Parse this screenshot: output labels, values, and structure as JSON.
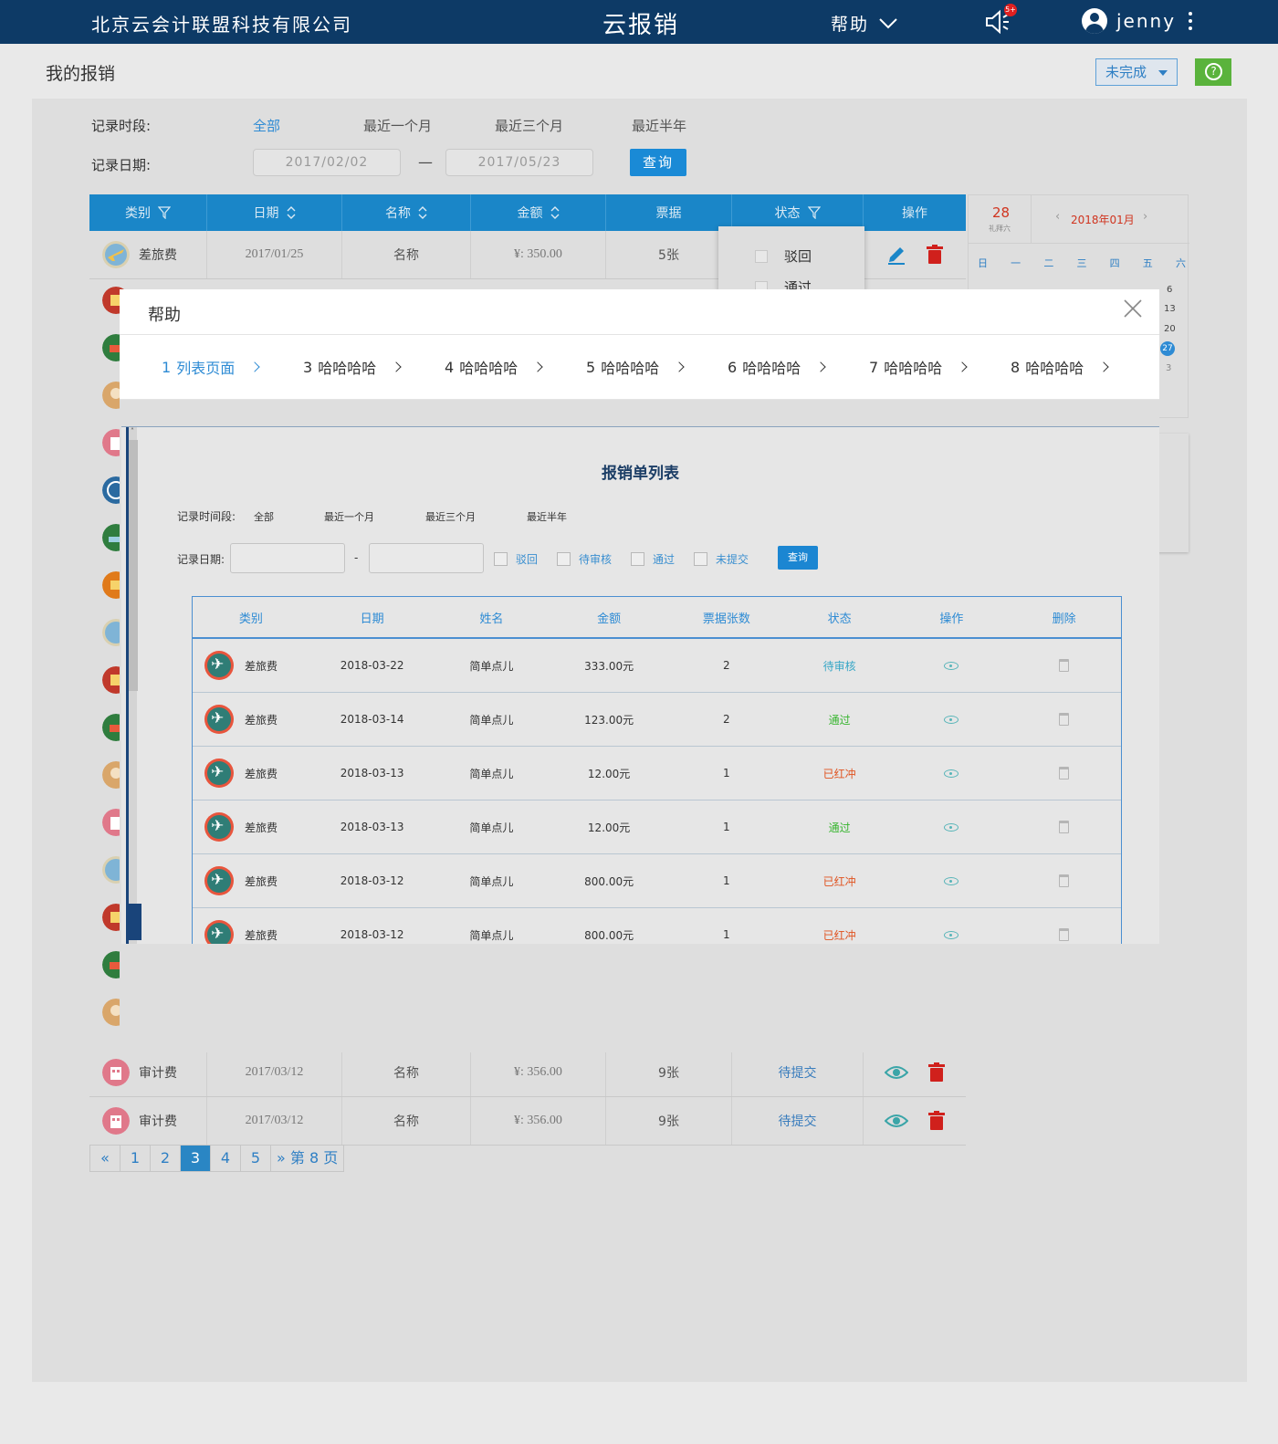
{
  "topbar": {
    "company": "北京云会计联盟科技有限公司",
    "app_title": "云报销",
    "help_label": "帮助",
    "notification_badge": "5+",
    "username": "jenny"
  },
  "page": {
    "title": "我的报销",
    "status_filter": "未完成"
  },
  "filters": {
    "period_label": "记录时段:",
    "periods": [
      "全部",
      "最近一个月",
      "最近三个月",
      "最近半年"
    ],
    "date_label": "记录日期:",
    "date_from": "2017/02/02",
    "date_sep": "—",
    "date_to": "2017/05/23",
    "query_label": "查询"
  },
  "main_table": {
    "headers": [
      "类别",
      "日期",
      "名称",
      "金额",
      "票据",
      "状态",
      "操作"
    ],
    "rows": [
      {
        "category": "差旅费",
        "date": "2017/01/25",
        "name": "名称",
        "amount": "¥: 350.00",
        "receipts": "5张",
        "status": ""
      },
      {
        "category": "审计费",
        "date": "2017/03/12",
        "name": "名称",
        "amount": "¥: 356.00",
        "receipts": "9张",
        "status": "待提交"
      },
      {
        "category": "审计费",
        "date": "2017/03/12",
        "name": "名称",
        "amount": "¥: 356.00",
        "receipts": "9张",
        "status": "待提交"
      }
    ],
    "status_popup": [
      "驳回",
      "通过"
    ]
  },
  "calendar": {
    "day": "28",
    "weekday": "礼拜六",
    "month": "2018年01月",
    "week_head": [
      "日",
      "一",
      "二",
      "三",
      "四",
      "五",
      "六"
    ],
    "visible_dates": [
      "6",
      "13",
      "20",
      "27",
      "3"
    ]
  },
  "pagination": {
    "pages": [
      "1",
      "2",
      "3",
      "4",
      "5"
    ],
    "current": "3",
    "last_label": "第 8 页"
  },
  "modal": {
    "title": "帮助",
    "steps": [
      {
        "num": "1",
        "label": "列表页面"
      },
      {
        "num": "3",
        "label": "哈哈哈哈"
      },
      {
        "num": "4",
        "label": "哈哈哈哈"
      },
      {
        "num": "5",
        "label": "哈哈哈哈"
      },
      {
        "num": "6",
        "label": "哈哈哈哈"
      },
      {
        "num": "7",
        "label": "哈哈哈哈"
      },
      {
        "num": "8",
        "label": "哈哈哈哈"
      }
    ],
    "screenshot": {
      "title": "报销单列表",
      "period_label": "记录时间段:",
      "periods": [
        "全部",
        "最近一个月",
        "最近三个月",
        "最近半年"
      ],
      "date_label": "记录日期:",
      "date_sep": "-",
      "checkboxes": [
        "驳回",
        "待审核",
        "通过",
        "未提交"
      ],
      "query_label": "查询",
      "headers": [
        "类别",
        "日期",
        "姓名",
        "金额",
        "票据张数",
        "状态",
        "操作",
        "删除"
      ],
      "rows": [
        {
          "category": "差旅费",
          "date": "2018-03-22",
          "name": "简单点儿",
          "amount": "333.00元",
          "count": "2",
          "status": "待审核"
        },
        {
          "category": "差旅费",
          "date": "2018-03-14",
          "name": "简单点儿",
          "amount": "123.00元",
          "count": "2",
          "status": "通过"
        },
        {
          "category": "差旅费",
          "date": "2018-03-13",
          "name": "简单点儿",
          "amount": "12.00元",
          "count": "1",
          "status": "已红冲"
        },
        {
          "category": "差旅费",
          "date": "2018-03-13",
          "name": "简单点儿",
          "amount": "12.00元",
          "count": "1",
          "status": "通过"
        },
        {
          "category": "差旅费",
          "date": "2018-03-12",
          "name": "简单点儿",
          "amount": "800.00元",
          "count": "1",
          "status": "已红冲"
        },
        {
          "category": "差旅费",
          "date": "2018-03-12",
          "name": "简单点儿",
          "amount": "800.00元",
          "count": "1",
          "status": "已红冲"
        }
      ]
    }
  },
  "colors": {
    "topbar": "#0d3a66",
    "accent": "#1a86c8",
    "danger": "#d0341f",
    "success": "#5ab33c"
  }
}
